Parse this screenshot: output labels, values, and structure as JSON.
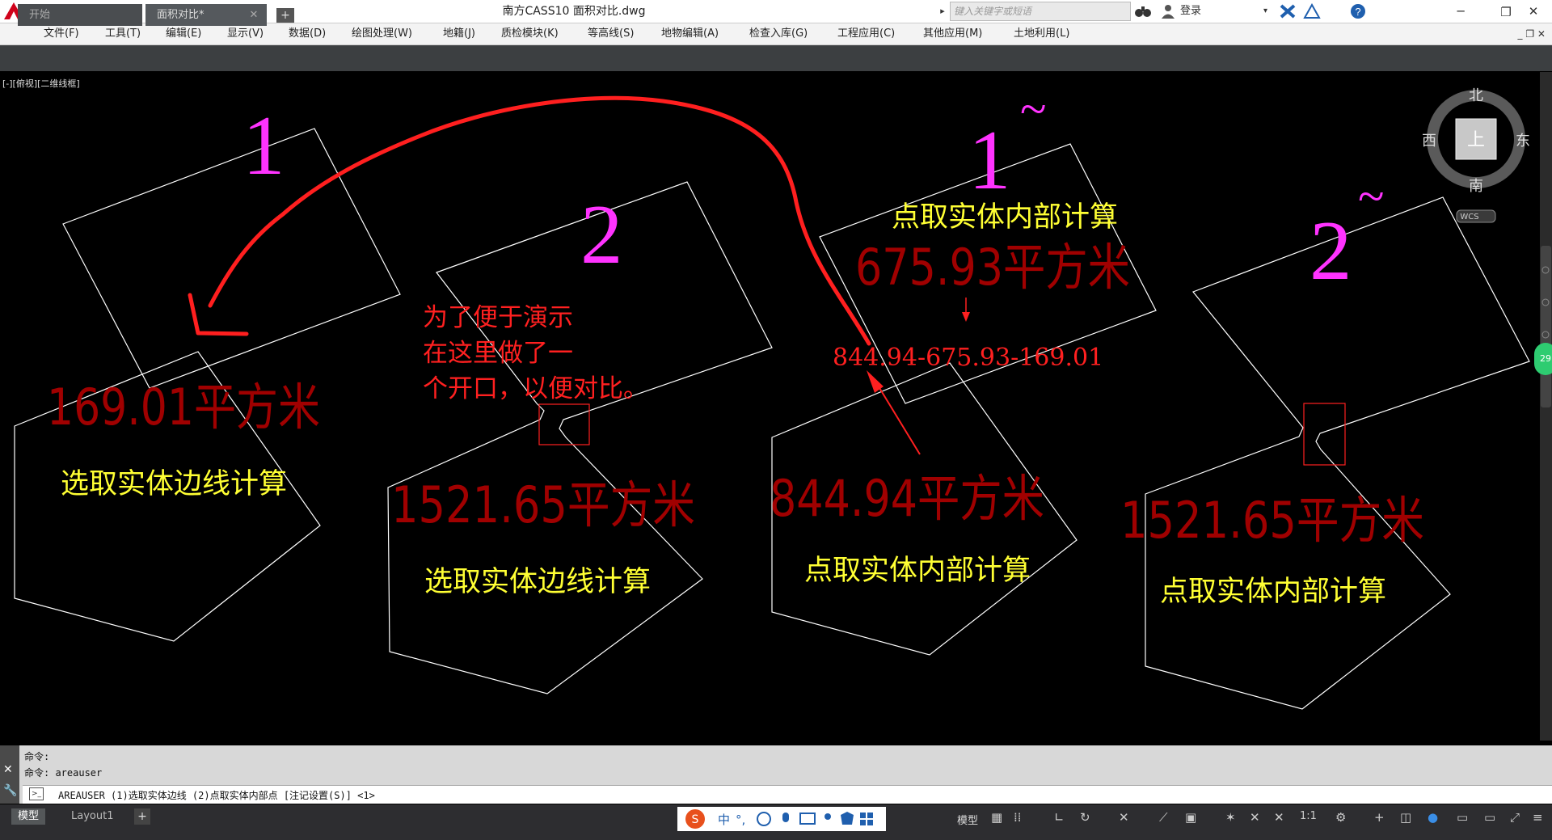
{
  "window": {
    "title": "南方CASS10    面积对比.dwg",
    "search_placeholder": "键入关键字或短语",
    "login": "登录"
  },
  "menus": [
    "文件(F)",
    "工具(T)",
    "编辑(E)",
    "显示(V)",
    "数据(D)",
    "绘图处理(W)",
    "地籍(J)",
    "质检模块(K)",
    "等高线(S)",
    "地物编辑(A)",
    "检查入库(G)",
    "工程应用(C)",
    "其他应用(M)",
    "土地利用(L)"
  ],
  "tabs": {
    "start": "开始",
    "current": "面积对比*"
  },
  "viewport": {
    "label": "[-][俯视][二维线框]"
  },
  "viewcube": {
    "north": "北",
    "south": "南",
    "east": "东",
    "west": "西",
    "top": "上",
    "wcs": "WCS"
  },
  "annotations": {
    "num_1": "1",
    "num_2": "2",
    "num_1b": "1",
    "num_2b": "2",
    "tilde": "~",
    "note_line1": "为了便于演示",
    "note_line2": "在这里做了一",
    "note_line3": "个开口，以便对比。",
    "formula": "844.94-675.93-169.01"
  },
  "shape_labels": {
    "area1": "169.01平方米",
    "area2": "1521.65平方米",
    "area3_top": "675.93平方米",
    "area3": "844.94平方米",
    "area4": "1521.65平方米",
    "method1": "选取实体边线计算",
    "method2": "选取实体边线计算",
    "method3_top": "点取实体内部计算",
    "method3": "点取实体内部计算",
    "method4": "点取实体内部计算"
  },
  "command": {
    "line1": "命令:",
    "line2": "命令: areauser",
    "current": "AREAUSER (1)选取实体边线 (2)点取实体内部点 [注记设置(S)] <1>"
  },
  "status": {
    "model_tab": "模型",
    "layout_tab": "Layout1",
    "model_label": "模型",
    "scale": "1:1",
    "ime_text": "中",
    "badge": "29"
  },
  "colors": {
    "magenta": "#ff33ff",
    "yellow": "#ffff33",
    "red": "#ff2020",
    "dimred": "#a00000",
    "white": "#ffffff"
  }
}
